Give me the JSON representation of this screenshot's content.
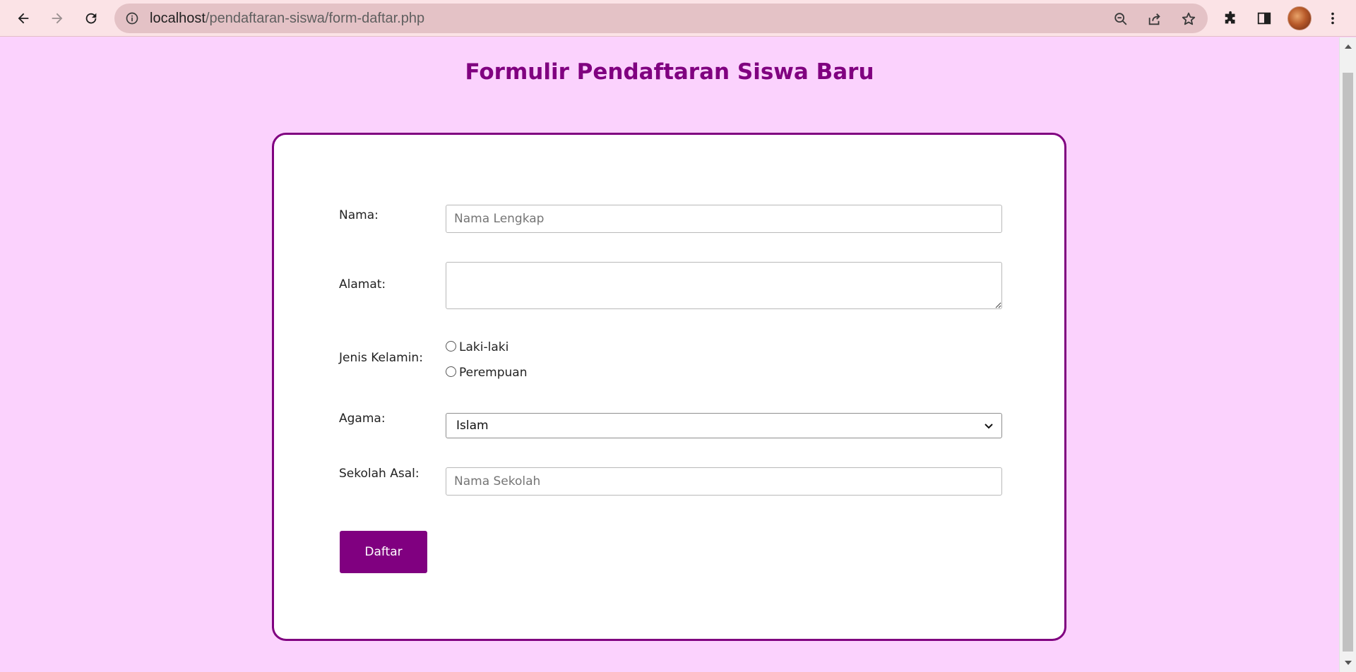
{
  "browser": {
    "url_host": "localhost",
    "url_path": "/pendaftaran-siswa/form-daftar.php",
    "icons": [
      "back-icon",
      "forward-icon",
      "reload-icon",
      "site-info-icon",
      "zoom-icon",
      "share-icon",
      "bookmark-star-icon",
      "extensions-icon",
      "side-panel-icon",
      "profile-avatar",
      "menu-kebab-icon"
    ]
  },
  "page": {
    "title": "Formulir Pendaftaran Siswa Baru",
    "accent_color": "#800080",
    "background_color": "#fbd2fd"
  },
  "form": {
    "nama": {
      "label": "Nama:",
      "placeholder": "Nama Lengkap",
      "value": ""
    },
    "alamat": {
      "label": "Alamat:",
      "value": ""
    },
    "jenis_kelamin": {
      "label": "Jenis Kelamin:",
      "options": [
        "Laki-laki",
        "Perempuan"
      ],
      "selected": null
    },
    "agama": {
      "label": "Agama:",
      "selected": "Islam"
    },
    "sekolah_asal": {
      "label": "Sekolah Asal:",
      "placeholder": "Nama Sekolah",
      "value": ""
    },
    "submit_label": "Daftar"
  }
}
